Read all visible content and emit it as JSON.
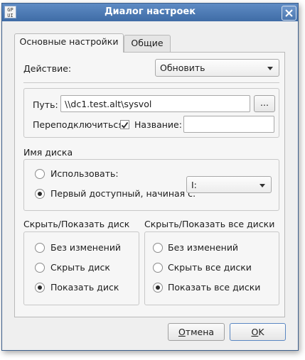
{
  "window": {
    "title": "Диалог настроек",
    "icon_text": [
      "GP",
      "UI"
    ]
  },
  "tabs": [
    {
      "label": "Основные настройки",
      "active": true
    },
    {
      "label": "Общие",
      "active": false
    }
  ],
  "action": {
    "label": "Действие:",
    "value": "Обновить"
  },
  "path": {
    "label": "Путь:",
    "value": "\\\\dc1.test.alt\\sysvol",
    "browse_label": "..."
  },
  "reconnect": {
    "label": "Переподключиться:",
    "checked": true
  },
  "name_field": {
    "label": "Название:",
    "value": ""
  },
  "disk_name": {
    "title": "Имя диска",
    "use_label": "Использовать:",
    "first_available_label": "Первый доступный, начиная с:",
    "selected_option": "first_available",
    "drive_value": "I:"
  },
  "hide_show_disk": {
    "title": "Скрыть/Показать диск",
    "options": [
      "Без изменений",
      "Скрыть диск",
      "Показать диск"
    ],
    "selected": 2
  },
  "hide_show_all": {
    "title": "Скрыть/Показать все диски",
    "options": [
      "Без изменений",
      "Скрыть все диски",
      "Показать все диски"
    ],
    "selected": 2
  },
  "buttons": {
    "cancel": {
      "mnemonic": "О",
      "rest": "тмена"
    },
    "ok": {
      "mnemonic": "O",
      "rest": "K"
    }
  }
}
